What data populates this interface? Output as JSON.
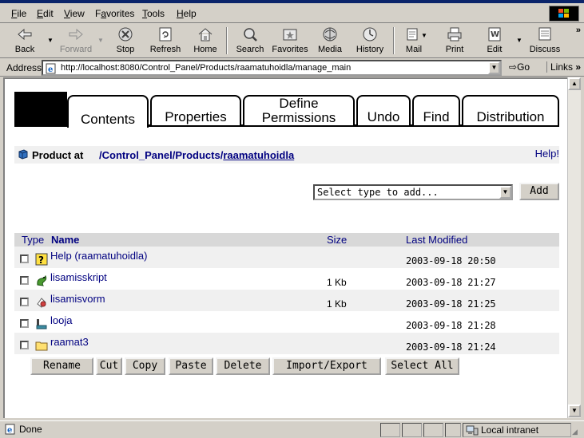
{
  "menu": {
    "items": [
      {
        "label": "File",
        "underline": "F",
        "rest": "ile"
      },
      {
        "label": "Edit",
        "underline": "E",
        "rest": "dit"
      },
      {
        "label": "View",
        "underline": "V",
        "rest": "iew"
      },
      {
        "label": "Favorites",
        "underline": "a",
        "pre": "F",
        "rest": "vorites"
      },
      {
        "label": "Tools",
        "underline": "T",
        "rest": "ools"
      },
      {
        "label": "Help",
        "underline": "H",
        "rest": "elp"
      }
    ]
  },
  "toolbar": {
    "back": "Back",
    "forward": "Forward",
    "stop": "Stop",
    "refresh": "Refresh",
    "home": "Home",
    "search": "Search",
    "favorites": "Favorites",
    "media": "Media",
    "history": "History",
    "mail": "Mail",
    "print": "Print",
    "edit": "Edit",
    "discuss": "Discuss",
    "more": "»"
  },
  "addressbar": {
    "label": "Address",
    "url": "http://localhost:8080/Control_Panel/Products/raamatuhoidla/manage_main",
    "go": "Go",
    "links": "Links",
    "links_more": "»"
  },
  "tabs": [
    {
      "label": "Contents",
      "active": true
    },
    {
      "label": "Properties",
      "active": false
    },
    {
      "label": "Define Permissions",
      "line1": "Define",
      "line2": "Permissions",
      "active": false
    },
    {
      "label": "Undo",
      "active": false
    },
    {
      "label": "Find",
      "active": false
    },
    {
      "label": "Distribution",
      "active": false
    }
  ],
  "breadcrumb": {
    "label": "Product at",
    "sep": "/",
    "parts": [
      "Control_Panel",
      "Products",
      "raamatuhoidla"
    ],
    "help": "Help!"
  },
  "add": {
    "select_value": "Select type to add...",
    "button": "Add"
  },
  "list": {
    "headers": {
      "type": "Type",
      "name": "Name",
      "size": "Size",
      "modified": "Last Modified"
    },
    "rows": [
      {
        "icon": "help-topic-icon",
        "name": "Help (raamatuhoidla)",
        "size": "",
        "modified": "2003-09-18 20:50"
      },
      {
        "icon": "python-script-icon",
        "name": "lisamisskript",
        "size": "1 Kb",
        "modified": "2003-09-18 21:27"
      },
      {
        "icon": "form-icon",
        "name": "lisamisvorm",
        "size": "1 Kb",
        "modified": "2003-09-18 21:25"
      },
      {
        "icon": "factory-icon",
        "name": "looja",
        "size": "",
        "modified": "2003-09-18 21:28"
      },
      {
        "icon": "folder-icon",
        "name": "raamat3",
        "size": "",
        "modified": "2003-09-18 21:24"
      }
    ]
  },
  "actions": {
    "rename": "Rename",
    "cut": "Cut",
    "copy": "Copy",
    "paste": "Paste",
    "delete": "Delete",
    "import_export": "Import/Export",
    "select_all": "Select All"
  },
  "status": {
    "text": "Done",
    "zone": "Local intranet"
  }
}
